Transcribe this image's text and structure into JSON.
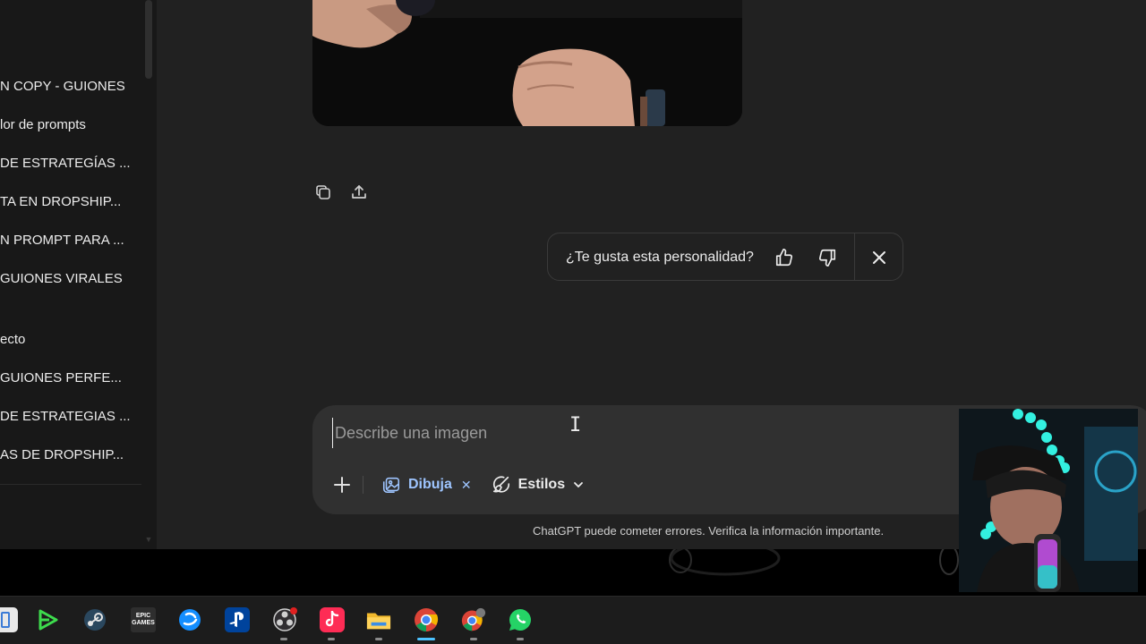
{
  "sidebar": {
    "items": [
      {
        "label": "N COPY - GUIONES"
      },
      {
        "label": "lor de prompts"
      },
      {
        "label": "DE ESTRATEGÍAS ..."
      },
      {
        "label": "TA EN DROPSHIP..."
      },
      {
        "label": "N PROMPT PARA ..."
      },
      {
        "label": "GUIONES VIRALES"
      },
      {
        "label": "ecto"
      },
      {
        "label": " GUIONES PERFE..."
      },
      {
        "label": "DE ESTRATEGIAS ..."
      },
      {
        "label": "AS DE DROPSHIP..."
      }
    ]
  },
  "message_actions": {
    "icons": [
      "copy-icon",
      "share-icon"
    ]
  },
  "feedback": {
    "question": "¿Te gusta esta personalidad?"
  },
  "composer": {
    "placeholder": "Describe una imagen",
    "tool_label": "Dibuja",
    "styles_label": "Estilos"
  },
  "disclaimer": "ChatGPT puede cometer errores. Verifica la información importante.",
  "taskbar": {
    "apps": [
      "app-icon",
      "gamepass-icon",
      "steam-icon",
      "epic-games-icon",
      "battlenet-icon",
      "playstation-icon",
      "obs-icon",
      "tiktok-icon",
      "file-explorer-icon",
      "chrome-icon",
      "chrome-profile-icon",
      "whatsapp-icon"
    ],
    "epic_text": "EPIC GAMES"
  },
  "colors": {
    "background": "#212121",
    "sidebar": "#181818",
    "composer": "#303030",
    "accent": "#9ec5ff"
  }
}
